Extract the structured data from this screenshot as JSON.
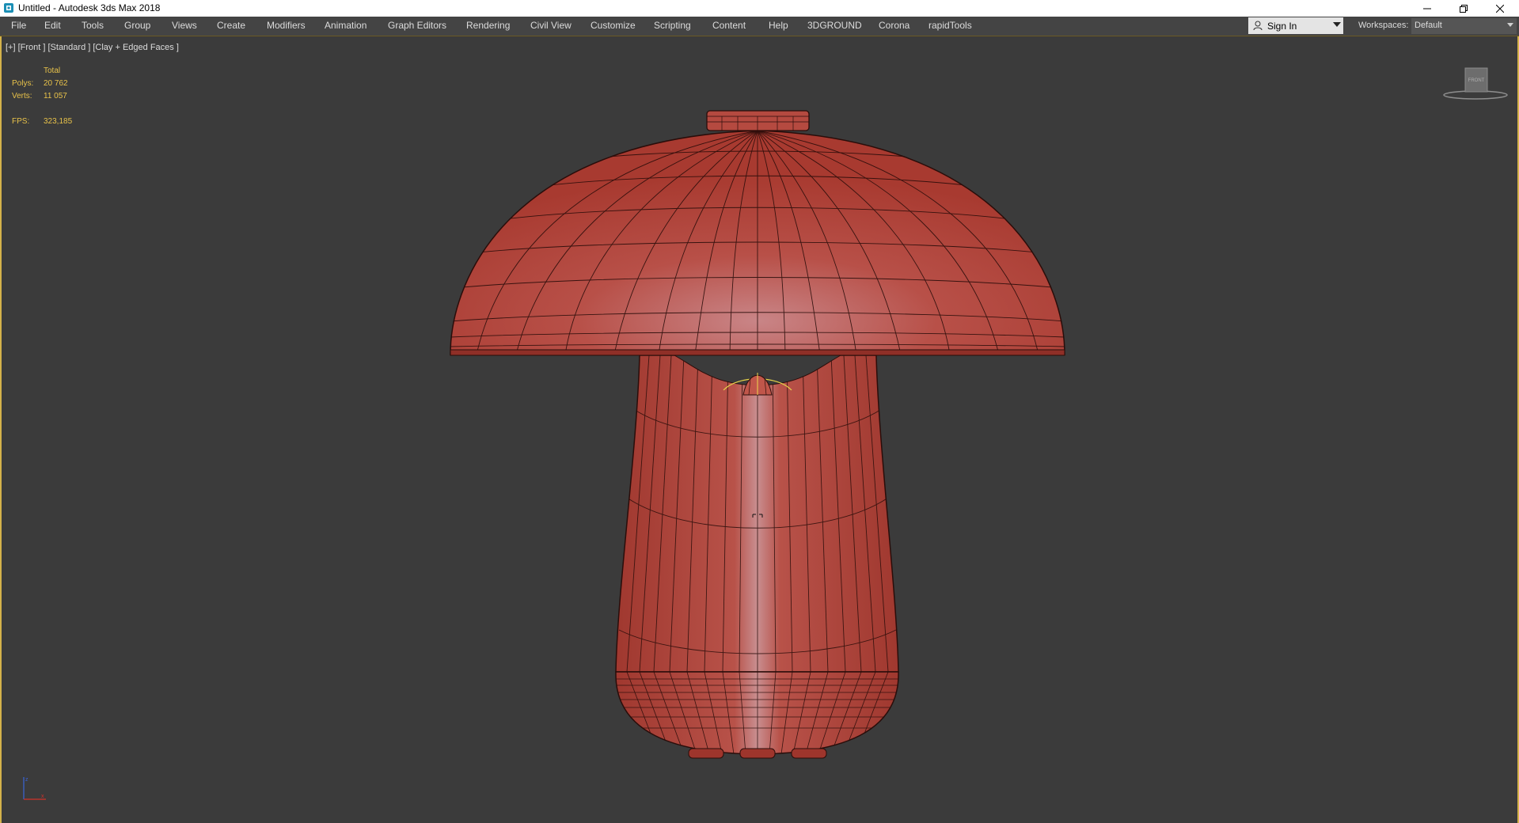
{
  "window": {
    "title": "Untitled - Autodesk 3ds Max 2018",
    "app_icon": "3dsmax-icon",
    "controls": [
      "minimize-icon",
      "restore-icon",
      "close-icon"
    ]
  },
  "menubar": {
    "items": [
      {
        "label": "File"
      },
      {
        "label": "Edit"
      },
      {
        "label": "Tools"
      },
      {
        "label": "Group"
      },
      {
        "label": "Views"
      },
      {
        "label": "Create"
      },
      {
        "label": "Modifiers"
      },
      {
        "label": "Animation"
      },
      {
        "label": "Graph Editors"
      },
      {
        "label": "Rendering"
      },
      {
        "label": "Civil View"
      },
      {
        "label": "Customize"
      },
      {
        "label": "Scripting"
      },
      {
        "label": "Content"
      },
      {
        "label": "Help"
      },
      {
        "label": "3DGROUND"
      },
      {
        "label": "Corona"
      },
      {
        "label": "rapidTools"
      }
    ],
    "sign_in": {
      "label": "Sign In",
      "icon": "user-icon"
    },
    "workspaces": {
      "label": "Workspaces:",
      "value": "Default"
    }
  },
  "viewport": {
    "label": "[+] [Front ] [Standard ] [Clay + Edged Faces ]",
    "stats": {
      "header": "Total",
      "polys_label": "Polys:",
      "polys_value": "20 762",
      "verts_label": "Verts:",
      "verts_value": "11 057",
      "fps_label": "FPS:",
      "fps_value": "323,185"
    },
    "viewcube_label": "FRONT",
    "model_color": "#b84a3e",
    "wire_color": "#2a0d0a",
    "stats_color": "#e8c24a",
    "active_border_color": "#d4b24a"
  }
}
